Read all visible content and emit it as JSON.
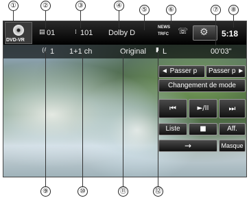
{
  "callouts": [
    "①",
    "②",
    "③",
    "④",
    "⑤",
    "⑥",
    "⑦",
    "⑧",
    "⑨",
    "⑩",
    "⑪",
    "⑫"
  ],
  "topbar": {
    "disc_label": "DVD-VR",
    "title_number": "01",
    "chapter_number": "101",
    "audio_format": "Dolby D",
    "news_label": "NEWS",
    "traffic_label": "TRFC",
    "clock": "5:18"
  },
  "infobar": {
    "audio_number": "1",
    "channels": "1+1 ch",
    "program": "Original",
    "subtitle_channel": "L",
    "elapsed_time": "00'03\""
  },
  "controls": {
    "passer_prev": "◄ Passer p",
    "passer_next": "Passer p ►",
    "mode_change": "Changement de mode",
    "prev_icon": "⏮",
    "play_pause_icon": "►/II",
    "next_icon": "⏭",
    "list": "Liste",
    "stop_icon": "■",
    "display": "Aff.",
    "arrow_icon": "→",
    "hide": "Masque"
  }
}
